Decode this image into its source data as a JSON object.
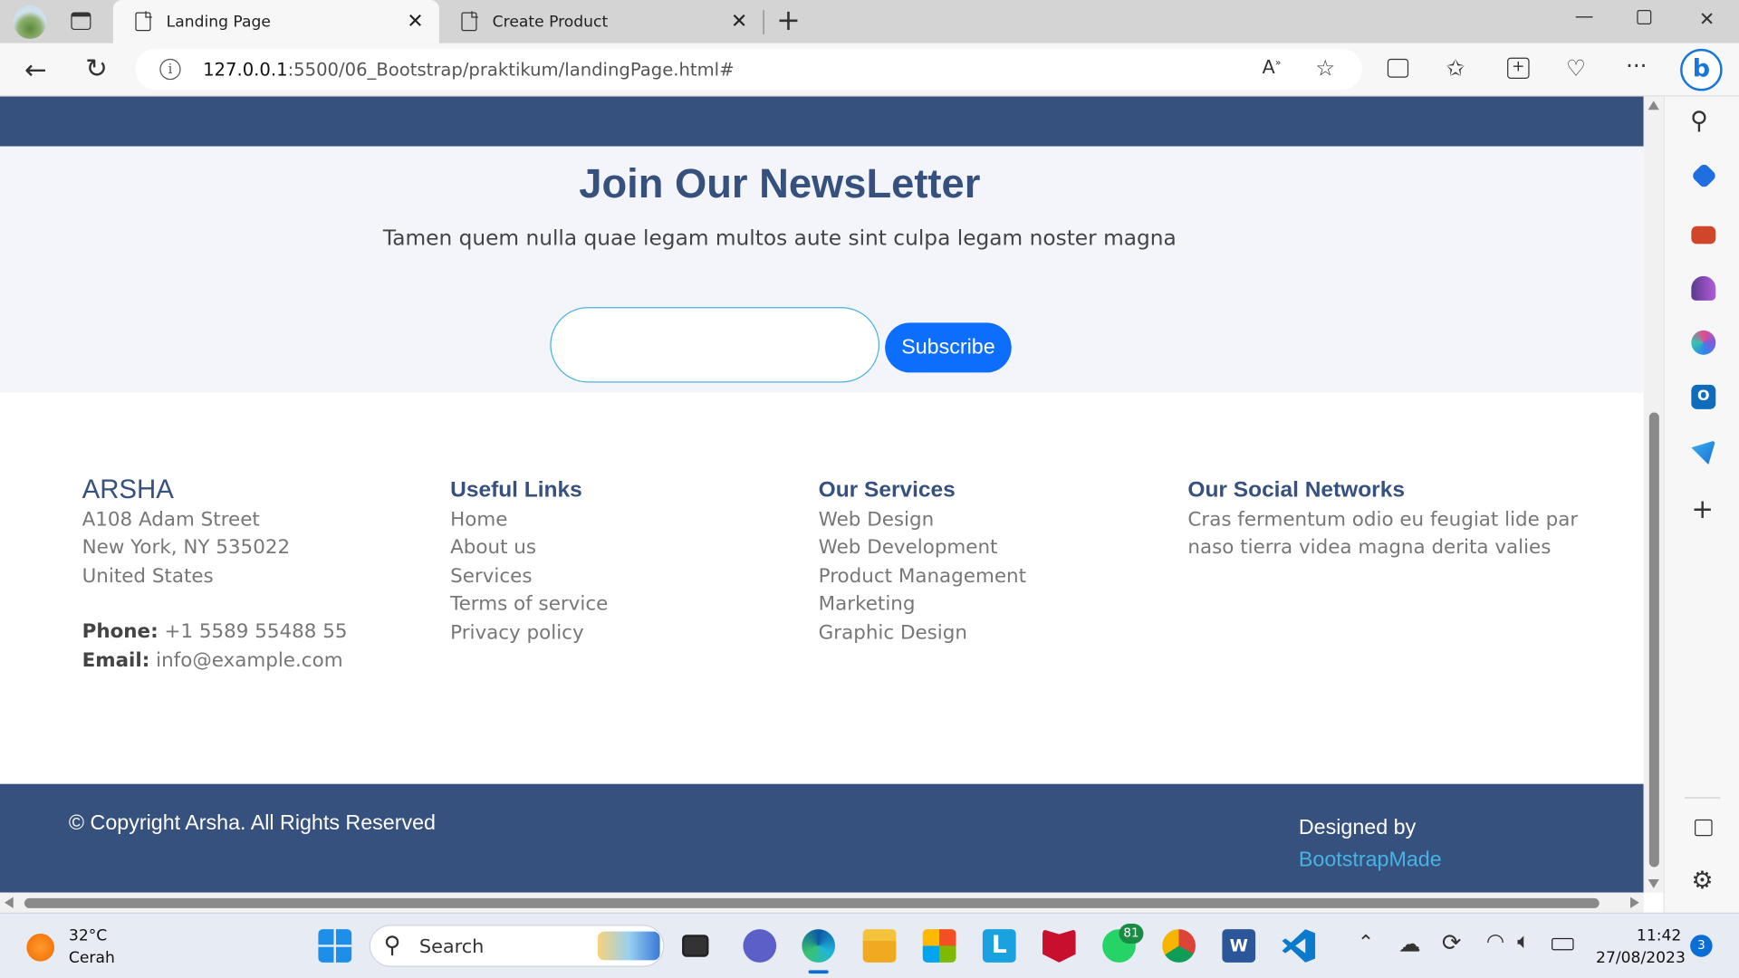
{
  "browser": {
    "tabs": [
      {
        "title": "Landing Page",
        "active": true
      },
      {
        "title": "Create Product",
        "active": false
      }
    ],
    "url_host": "127.0.0.1",
    "url_path": ":5500/06_Bootstrap/praktikum/landingPage.html#"
  },
  "newsletter": {
    "title": "Join Our NewsLetter",
    "subtitle": "Tamen quem nulla quae legam multos aute sint culpa legam noster magna",
    "input_value": "",
    "button": "Subscribe"
  },
  "footer": {
    "brand": "ARSHA",
    "address": [
      "A108 Adam Street",
      "New York, NY 535022",
      "United States"
    ],
    "phone_label": "Phone:",
    "phone": "+1 5589 55488 55",
    "email_label": "Email:",
    "email": "info@example.com",
    "useful_links_title": "Useful Links",
    "useful_links": [
      "Home",
      "About us",
      "Services",
      "Terms of service",
      "Privacy policy"
    ],
    "services_title": "Our Services",
    "services": [
      "Web Design",
      "Web Development",
      "Product Management",
      "Marketing",
      "Graphic Design"
    ],
    "social_title": "Our Social Networks",
    "social_text": [
      "Cras fermentum odio eu feugiat lide par",
      "naso tierra videa magna derita valies"
    ],
    "copyright": "© Copyright Arsha. All Rights Reserved",
    "designed_by": "Designed by",
    "designer_link": "BootstrapMade"
  },
  "taskbar": {
    "weather_temp": "32°C",
    "weather_desc": "Cerah",
    "search": "Search",
    "whatsapp_badge": "81",
    "time": "11:42",
    "date": "27/08/2023",
    "notifications": "3"
  },
  "colors": {
    "primary": "#37517e",
    "accent": "#47b2e4",
    "button": "#0d6efd"
  }
}
